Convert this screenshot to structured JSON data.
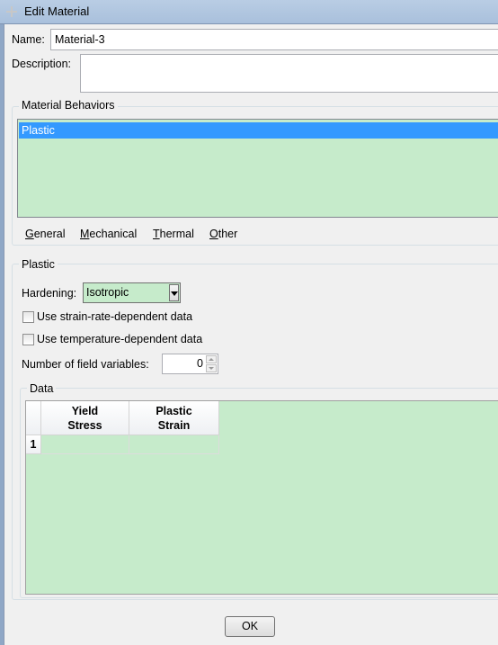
{
  "window": {
    "title": "Edit Material"
  },
  "name": {
    "label": "Name:",
    "value": "Material-3"
  },
  "description": {
    "label": "Description:",
    "value": ""
  },
  "behaviors": {
    "group_title": "Material Behaviors",
    "items": [
      "Plastic"
    ],
    "selected": "Plastic"
  },
  "menus": [
    "General",
    "Mechanical",
    "Thermal",
    "Other"
  ],
  "plastic": {
    "group_title": "Plastic",
    "hardening_label": "Hardening:",
    "hardening_value": "Isotropic",
    "strain_rate_label": "Use strain-rate-dependent data",
    "strain_rate_checked": false,
    "temperature_label": "Use temperature-dependent data",
    "temperature_checked": false,
    "field_vars_label": "Number of field variables:",
    "field_vars_value": "0"
  },
  "data_table": {
    "group_title": "Data",
    "columns": [
      {
        "line1": "Yield",
        "line2": "Stress"
      },
      {
        "line1": "Plastic",
        "line2": "Strain"
      }
    ],
    "rows": [
      {
        "index": "1",
        "cells": [
          "",
          ""
        ]
      }
    ]
  },
  "buttons": {
    "ok": "OK"
  },
  "colors": {
    "field_bg": "#c6ebcb",
    "selection": "#3399ff"
  }
}
